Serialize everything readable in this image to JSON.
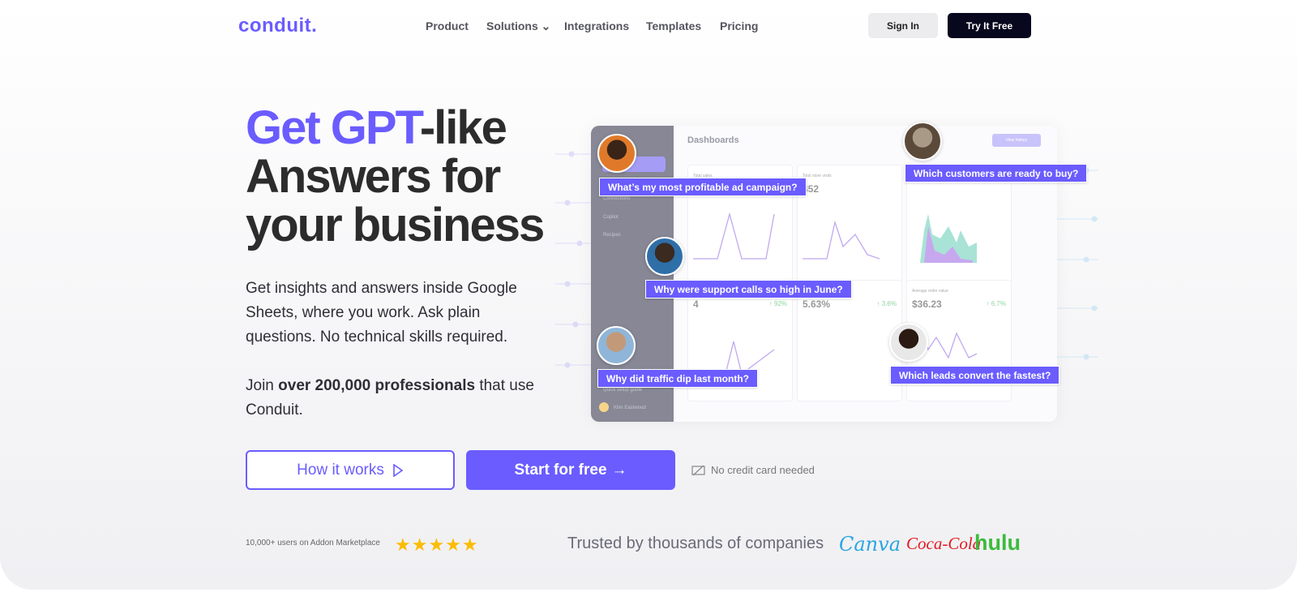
{
  "brand": {
    "logo": "conduit.",
    "accent": "#6a5cff"
  },
  "nav": {
    "items": [
      "Product",
      "Solutions",
      "Integrations",
      "Templates",
      "Pricing"
    ],
    "sign_in": "Sign In",
    "try_free": "Try It Free"
  },
  "hero": {
    "title_accent": "Get GPT",
    "title_rest": "-like",
    "title_line2": "Answers for",
    "title_line3": "your business",
    "desc": "Get insights and answers inside Google Sheets, where you work. Ask plain questions. No technical skills required.",
    "join_pre": "Join ",
    "join_bold": "over 200,000 professionals",
    "join_post": " that use Conduit.",
    "how_label": "How it works",
    "start_label": "Start for free",
    "start_arrow": "→",
    "no_cc": "No credit card needed"
  },
  "dashboard": {
    "title": "Dashboards",
    "view_history": "View history",
    "sidebar": [
      "Connections",
      "Copilot",
      "Recipes",
      "Quick setup guide",
      "Klim Eastwood"
    ],
    "cards": [
      {
        "label": "Total sales",
        "value": "",
        "change": ""
      },
      {
        "label": "Total store visits",
        "value": "452",
        "change": ""
      },
      {
        "label": "CUSTOMERS",
        "value": "",
        "change": ""
      },
      {
        "label": "ORDERS OVER TIME",
        "value": "4",
        "change": "↑ 92%"
      },
      {
        "label": "Conversion rate",
        "value": "5.63%",
        "change": "↑ 3.6%"
      },
      {
        "label": "Average order value",
        "value": "$36.23",
        "change": "↑ 6.7%"
      }
    ],
    "questions": [
      "What’s my most profitable ad campaign?",
      "Which customers are ready to buy?",
      "Why were support calls so high in June?",
      "Why did traffic dip last month?",
      "Which leads convert the fastest?"
    ]
  },
  "footer": {
    "users": "10,000+ users on Addon Marketplace",
    "rating": 5,
    "stars": "★★★★★",
    "trusted": "Trusted by thousands of companies",
    "logos": [
      "Canva",
      "Coca-Cola",
      "hulu"
    ]
  }
}
